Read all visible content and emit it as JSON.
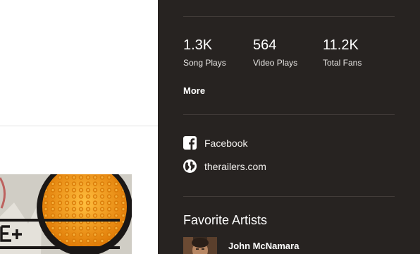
{
  "stats": [
    {
      "value": "1.3K",
      "label": "Song Plays"
    },
    {
      "value": "564",
      "label": "Video Plays"
    },
    {
      "value": "11.2K",
      "label": "Total Fans"
    }
  ],
  "more_label": "More",
  "social_links": [
    {
      "icon": "facebook-icon",
      "label": "Facebook"
    },
    {
      "icon": "globe-icon",
      "label": "therailers.com"
    }
  ],
  "favorite_artists": {
    "title": "Favorite Artists",
    "items": [
      {
        "name": "John McNamara"
      }
    ]
  },
  "colors": {
    "panel_background": "#272321",
    "divider": "#423c39",
    "text": "#ffffff"
  }
}
